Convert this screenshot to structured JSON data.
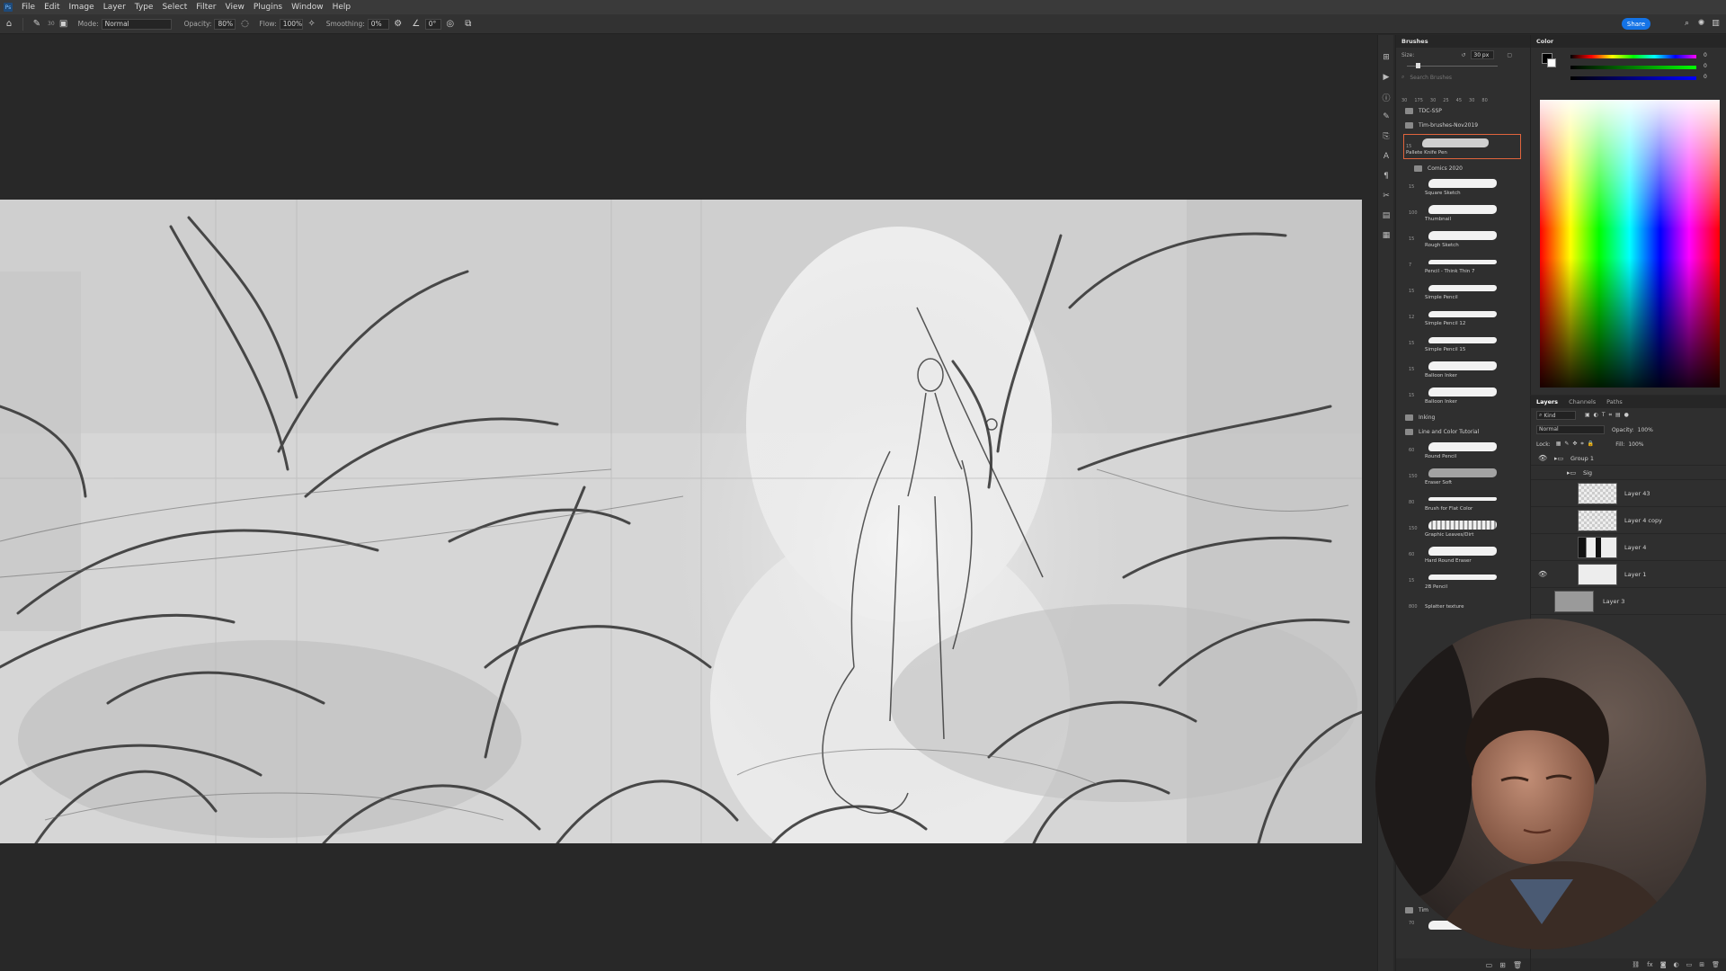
{
  "menubar": {
    "app_icon": "photoshop-logo-icon",
    "items": [
      "File",
      "Edit",
      "Image",
      "Layer",
      "Type",
      "Select",
      "Filter",
      "View",
      "Plugins",
      "Window",
      "Help"
    ]
  },
  "options": {
    "brush_size": "30",
    "mode_label": "Mode:",
    "mode_value": "Normal",
    "opacity_label": "Opacity:",
    "opacity_value": "80%",
    "flow_label": "Flow:",
    "flow_value": "100%",
    "smoothing_label": "Smoothing:",
    "smoothing_value": "0%",
    "angle_value": "0°",
    "share_label": "Share"
  },
  "brushes": {
    "title": "Brushes",
    "size_label": "Size:",
    "size_value": "30 px",
    "search_placeholder": "Search Brushes",
    "preset_sizes": [
      "30",
      "175",
      "30",
      "25",
      "45",
      "30",
      "80"
    ],
    "folders": {
      "tdc": "TDC-SSP",
      "tim": "Tim-brushes-Nov2019",
      "comics": "Comics 2020",
      "inking": "Inking",
      "line_color": "Line and Color Tutorial",
      "tim2": "Tim"
    },
    "selected": {
      "size": "15",
      "name": "Pallete Knife Pen"
    },
    "comics_items": [
      {
        "size": "15",
        "name": "Square Sketch"
      },
      {
        "size": "100",
        "name": "Thumbnail"
      },
      {
        "size": "15",
        "name": "Rough Sketch"
      },
      {
        "size": "7",
        "name": "Pencil - Think Thin 7"
      },
      {
        "size": "15",
        "name": "Simple Pencil"
      },
      {
        "size": "12",
        "name": "Simple Pencil 12"
      },
      {
        "size": "15",
        "name": "Simple Pencil 15"
      },
      {
        "size": "15",
        "name": "Balloon Inker"
      },
      {
        "size": "15",
        "name": "Balloon Inker"
      }
    ],
    "tutorial_items": [
      {
        "size": "60",
        "name": "Round Pencil"
      },
      {
        "size": "150",
        "name": "Eraser Soft"
      },
      {
        "size": "80",
        "name": "Brush for Flat Color"
      },
      {
        "size": "150",
        "name": "Graphic Leaves/Dirt"
      },
      {
        "size": "60",
        "name": "Hard Round Eraser"
      },
      {
        "size": "15",
        "name": "2B Pencil"
      },
      {
        "size": "800",
        "name": "Splatter texture"
      }
    ],
    "last_item_size": "70"
  },
  "color": {
    "title": "Color",
    "r": "0",
    "g": "0",
    "b": "0"
  },
  "layers": {
    "tabs": [
      "Layers",
      "Channels",
      "Paths"
    ],
    "kind_label": "Kind",
    "blend_mode": "Normal",
    "opacity_label": "Opacity:",
    "opacity_value": "100%",
    "lock_label": "Lock:",
    "fill_label": "Fill:",
    "fill_value": "100%",
    "items": [
      {
        "name": "Group 1",
        "type": "group"
      },
      {
        "name": "Sig",
        "type": "group"
      },
      {
        "name": "Layer 43"
      },
      {
        "name": "Layer 4 copy"
      },
      {
        "name": "Layer 4"
      },
      {
        "name": "Layer 1"
      },
      {
        "name": "Layer 3"
      }
    ]
  },
  "colors": {
    "accent": "#1473e6",
    "selected_brush_border": "#e0643c"
  }
}
